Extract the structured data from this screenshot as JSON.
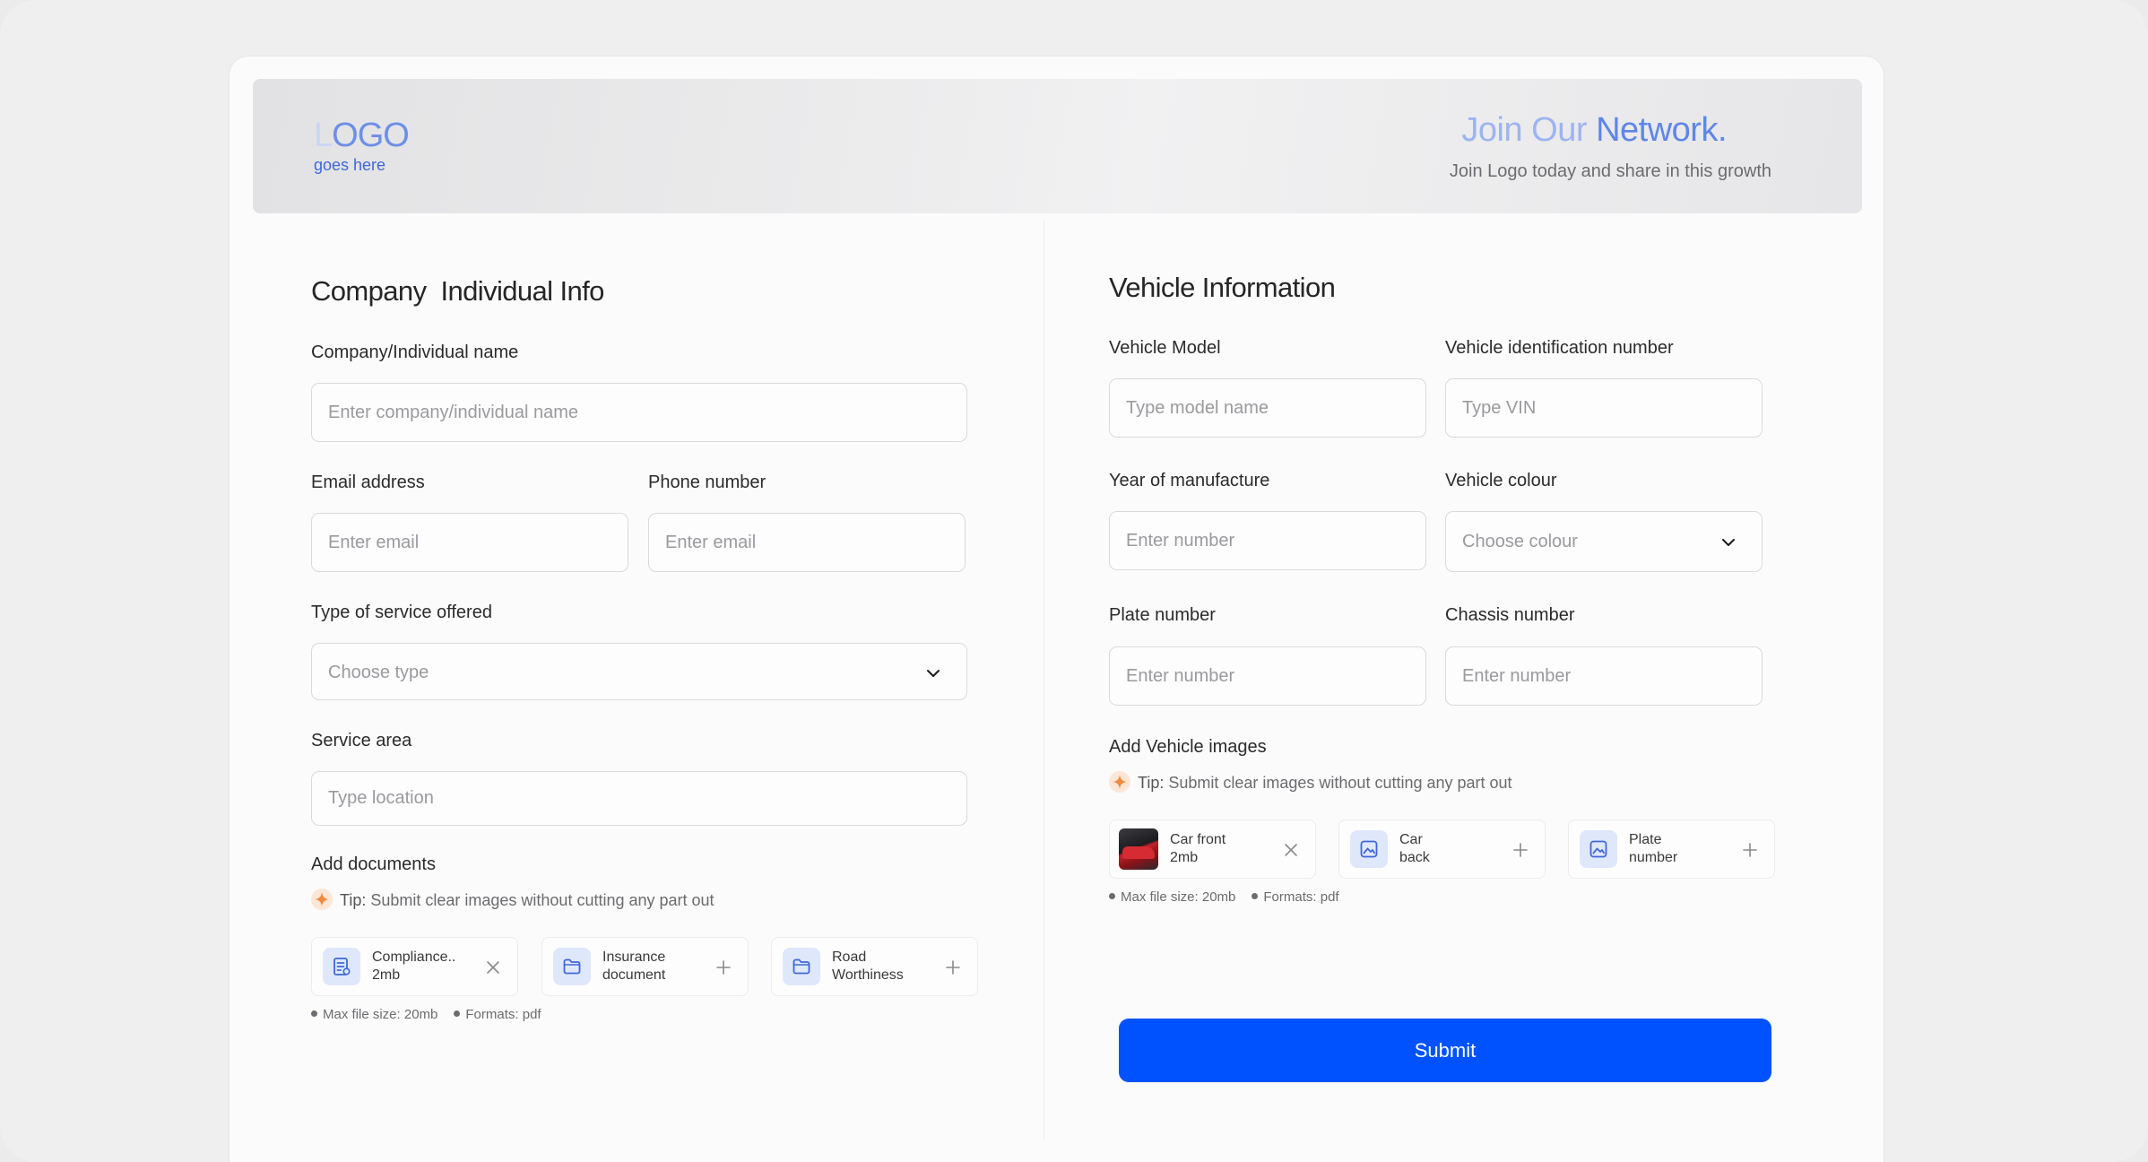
{
  "header": {
    "logo_main": "LOGO",
    "logo_first_letter": "L",
    "logo_rest": "OGO",
    "logo_sub": "goes here",
    "title_part1": "Join Our ",
    "title_part2": "Network.",
    "subtitle": "Join Logo today and share in this growth"
  },
  "company": {
    "title_word1": "Company",
    "title_word2": "Individual Info",
    "name_label": "Company/Individual name",
    "name_placeholder": "Enter company/individual name",
    "email_label": "Email address",
    "email_placeholder": "Enter email",
    "phone_label": "Phone number",
    "phone_placeholder": "Enter email",
    "service_label": "Type of service offered",
    "service_placeholder": "Choose type",
    "area_label": "Service area",
    "area_placeholder": "Type location",
    "docs_label": "Add documents",
    "tip_prefix": "Tip:",
    "tip_text": " Submit clear images without cutting any part out",
    "documents": [
      {
        "name": "Compliance..",
        "size": "2mb",
        "icon": "document-icon",
        "action": "close-icon"
      },
      {
        "name": "Insurance",
        "name2": "document",
        "icon": "folder-icon",
        "action": "plus-icon"
      },
      {
        "name": "Road",
        "name2": "Worthiness",
        "icon": "folder-icon",
        "action": "plus-icon"
      }
    ],
    "max_size": "Max file size: 20mb",
    "formats": "Formats: pdf"
  },
  "vehicle": {
    "title": "Vehicle Information",
    "model_label": "Vehicle Model",
    "model_placeholder": "Type model name",
    "vin_label": "Vehicle identification number",
    "vin_placeholder": "Type VIN",
    "year_label": "Year of manufacture",
    "year_placeholder": "Enter number",
    "colour_label": "Vehicle colour",
    "colour_placeholder": "Choose colour",
    "plate_label": "Plate number",
    "plate_placeholder": "Enter number",
    "chassis_label": "Chassis number",
    "chassis_placeholder": "Enter number",
    "images_label": "Add Vehicle images",
    "tip_prefix": "Tip:",
    "tip_text": " Submit clear images without cutting any part out",
    "images": [
      {
        "name": "Car front",
        "size": "2mb",
        "icon": "car-photo-thumbnail",
        "action": "close-icon"
      },
      {
        "name": "Car",
        "name2": "back",
        "icon": "image-icon",
        "action": "plus-icon"
      },
      {
        "name": "Plate",
        "name2": "number",
        "icon": "image-icon",
        "action": "plus-icon"
      }
    ],
    "max_size": "Max file size: 20mb",
    "formats": "Formats: pdf"
  },
  "submit_label": "Submit",
  "colors": {
    "accent": "#0052ff",
    "banner_title": "#5f86e8",
    "tip_spark": "#f08a3c"
  }
}
